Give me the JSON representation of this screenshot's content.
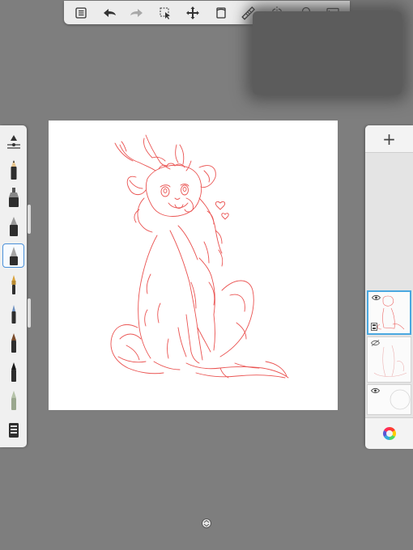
{
  "app": {
    "accent": "#4a90d9",
    "sketch_color": "#e8413f"
  },
  "toolbar": {
    "items": [
      {
        "icon": "menu-list-icon"
      },
      {
        "icon": "undo-icon"
      },
      {
        "icon": "redo-icon"
      },
      {
        "icon": "selection-icon"
      },
      {
        "icon": "transform-icon"
      },
      {
        "icon": "canvas-rotate-icon"
      },
      {
        "icon": "ruler-icon"
      },
      {
        "icon": "symmetry-icon"
      },
      {
        "icon": "shapes-icon"
      },
      {
        "icon": "fullscreen-icon"
      }
    ]
  },
  "brushes": {
    "items": [
      {
        "icon": "brush-properties-icon"
      },
      {
        "icon": "pencil-icon"
      },
      {
        "icon": "airbrush-icon"
      },
      {
        "icon": "ballpoint-pen-icon"
      },
      {
        "icon": "marker-icon",
        "selected": true
      },
      {
        "icon": "paintbrush-icon"
      },
      {
        "icon": "fine-brush-icon"
      },
      {
        "icon": "chisel-brush-icon"
      },
      {
        "icon": "ink-brush-icon"
      },
      {
        "icon": "eraser-icon"
      },
      {
        "icon": "brush-library-icon"
      }
    ]
  },
  "layers": {
    "add_label": "+",
    "items": [
      {
        "name": "sketch-layer",
        "visible": true,
        "active": true
      },
      {
        "name": "base-sketch-layer",
        "visible": false,
        "active": false
      },
      {
        "name": "background-layer",
        "visible": true,
        "active": false
      }
    ]
  },
  "color_button": {
    "icon": "color-wheel-icon"
  }
}
